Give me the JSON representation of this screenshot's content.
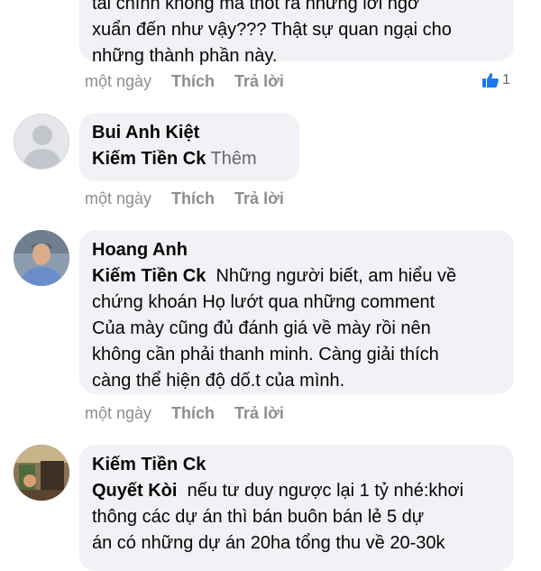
{
  "comments": [
    {
      "text_lines": [
        "tài chính không mà thốt ra những lời ngờ",
        "xuẩn đến như vậy??? Thật sự quan ngại cho",
        "những thành phần này."
      ],
      "time": "một ngày",
      "like_label": "Thích",
      "reply_label": "Trả lời",
      "reaction_count": "1"
    },
    {
      "author": "Bui Anh Kiệt",
      "tag": "Kiếm Tiền Ck",
      "more_label": "Thêm",
      "time": "một ngày",
      "like_label": "Thích",
      "reply_label": "Trả lời"
    },
    {
      "author": "Hoang Anh",
      "tag": "Kiếm Tiền Ck",
      "text_first": "Những người biết, am hiểu về",
      "text_lines": [
        "chứng khoán Họ lướt qua những comment",
        "Của mày cũng đủ đánh giá về mày rồi nên",
        "không cần phải thanh minh. Càng giải thích",
        "càng thể hiện độ dố.t của mình."
      ],
      "time": "một ngày",
      "like_label": "Thích",
      "reply_label": "Trả lời"
    },
    {
      "author": "Kiếm Tiền Ck",
      "tag": "Quyết Kòi",
      "text_first": "nếu tư duy ngược lại 1 tỷ nhé:khơi",
      "text_lines": [
        "thông các dự án thì bán buôn bán lẻ 5 dự",
        "án có những dự án 20ha tổng thu về 20-30k"
      ]
    }
  ],
  "colors": {
    "bubble_bg": "#f0f2f5",
    "muted_text": "#8a8d91",
    "like_blue": "#1877f2"
  },
  "icons": [
    "thumbs-up-icon",
    "default-avatar-icon"
  ]
}
